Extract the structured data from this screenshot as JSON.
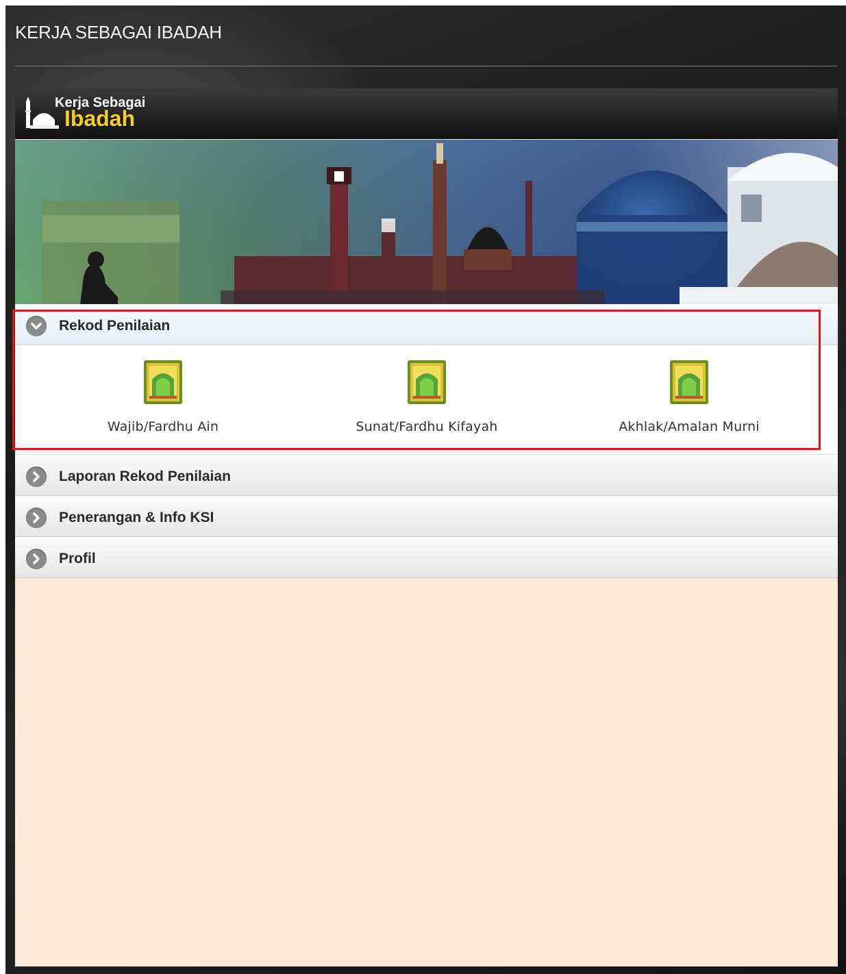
{
  "page": {
    "title": "KERJA SEBAGAI IBADAH"
  },
  "logo": {
    "line1": "Kerja Sebagai",
    "line2": "Ibadah"
  },
  "accordion": [
    {
      "label": "Rekod Penilaian",
      "expanded": true,
      "items": [
        {
          "label": "Wajib/Fardhu Ain",
          "icon": "prayer-mat-icon"
        },
        {
          "label": "Sunat/Fardhu Kifayah",
          "icon": "prayer-mat-icon"
        },
        {
          "label": "Akhlak/Amalan Murni",
          "icon": "prayer-mat-icon"
        }
      ]
    },
    {
      "label": "Laporan Rekod Penilaian",
      "expanded": false
    },
    {
      "label": "Penerangan & Info KSI",
      "expanded": false
    },
    {
      "label": "Profil",
      "expanded": false
    }
  ],
  "colors": {
    "highlight": "#e8141c",
    "logo_accent": "#f3d21a",
    "content_bg": "#fce9d8"
  }
}
